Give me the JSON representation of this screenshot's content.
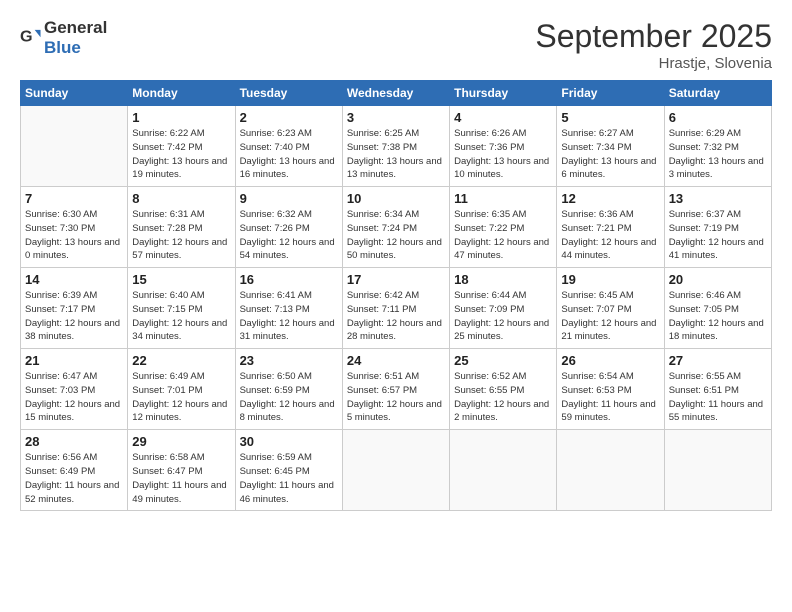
{
  "logo": {
    "general": "General",
    "blue": "Blue"
  },
  "title": "September 2025",
  "subtitle": "Hrastje, Slovenia",
  "headers": [
    "Sunday",
    "Monday",
    "Tuesday",
    "Wednesday",
    "Thursday",
    "Friday",
    "Saturday"
  ],
  "weeks": [
    [
      {
        "day": "",
        "sunrise": "",
        "sunset": "",
        "daylight": ""
      },
      {
        "day": "1",
        "sunrise": "Sunrise: 6:22 AM",
        "sunset": "Sunset: 7:42 PM",
        "daylight": "Daylight: 13 hours and 19 minutes."
      },
      {
        "day": "2",
        "sunrise": "Sunrise: 6:23 AM",
        "sunset": "Sunset: 7:40 PM",
        "daylight": "Daylight: 13 hours and 16 minutes."
      },
      {
        "day": "3",
        "sunrise": "Sunrise: 6:25 AM",
        "sunset": "Sunset: 7:38 PM",
        "daylight": "Daylight: 13 hours and 13 minutes."
      },
      {
        "day": "4",
        "sunrise": "Sunrise: 6:26 AM",
        "sunset": "Sunset: 7:36 PM",
        "daylight": "Daylight: 13 hours and 10 minutes."
      },
      {
        "day": "5",
        "sunrise": "Sunrise: 6:27 AM",
        "sunset": "Sunset: 7:34 PM",
        "daylight": "Daylight: 13 hours and 6 minutes."
      },
      {
        "day": "6",
        "sunrise": "Sunrise: 6:29 AM",
        "sunset": "Sunset: 7:32 PM",
        "daylight": "Daylight: 13 hours and 3 minutes."
      }
    ],
    [
      {
        "day": "7",
        "sunrise": "Sunrise: 6:30 AM",
        "sunset": "Sunset: 7:30 PM",
        "daylight": "Daylight: 13 hours and 0 minutes."
      },
      {
        "day": "8",
        "sunrise": "Sunrise: 6:31 AM",
        "sunset": "Sunset: 7:28 PM",
        "daylight": "Daylight: 12 hours and 57 minutes."
      },
      {
        "day": "9",
        "sunrise": "Sunrise: 6:32 AM",
        "sunset": "Sunset: 7:26 PM",
        "daylight": "Daylight: 12 hours and 54 minutes."
      },
      {
        "day": "10",
        "sunrise": "Sunrise: 6:34 AM",
        "sunset": "Sunset: 7:24 PM",
        "daylight": "Daylight: 12 hours and 50 minutes."
      },
      {
        "day": "11",
        "sunrise": "Sunrise: 6:35 AM",
        "sunset": "Sunset: 7:22 PM",
        "daylight": "Daylight: 12 hours and 47 minutes."
      },
      {
        "day": "12",
        "sunrise": "Sunrise: 6:36 AM",
        "sunset": "Sunset: 7:21 PM",
        "daylight": "Daylight: 12 hours and 44 minutes."
      },
      {
        "day": "13",
        "sunrise": "Sunrise: 6:37 AM",
        "sunset": "Sunset: 7:19 PM",
        "daylight": "Daylight: 12 hours and 41 minutes."
      }
    ],
    [
      {
        "day": "14",
        "sunrise": "Sunrise: 6:39 AM",
        "sunset": "Sunset: 7:17 PM",
        "daylight": "Daylight: 12 hours and 38 minutes."
      },
      {
        "day": "15",
        "sunrise": "Sunrise: 6:40 AM",
        "sunset": "Sunset: 7:15 PM",
        "daylight": "Daylight: 12 hours and 34 minutes."
      },
      {
        "day": "16",
        "sunrise": "Sunrise: 6:41 AM",
        "sunset": "Sunset: 7:13 PM",
        "daylight": "Daylight: 12 hours and 31 minutes."
      },
      {
        "day": "17",
        "sunrise": "Sunrise: 6:42 AM",
        "sunset": "Sunset: 7:11 PM",
        "daylight": "Daylight: 12 hours and 28 minutes."
      },
      {
        "day": "18",
        "sunrise": "Sunrise: 6:44 AM",
        "sunset": "Sunset: 7:09 PM",
        "daylight": "Daylight: 12 hours and 25 minutes."
      },
      {
        "day": "19",
        "sunrise": "Sunrise: 6:45 AM",
        "sunset": "Sunset: 7:07 PM",
        "daylight": "Daylight: 12 hours and 21 minutes."
      },
      {
        "day": "20",
        "sunrise": "Sunrise: 6:46 AM",
        "sunset": "Sunset: 7:05 PM",
        "daylight": "Daylight: 12 hours and 18 minutes."
      }
    ],
    [
      {
        "day": "21",
        "sunrise": "Sunrise: 6:47 AM",
        "sunset": "Sunset: 7:03 PM",
        "daylight": "Daylight: 12 hours and 15 minutes."
      },
      {
        "day": "22",
        "sunrise": "Sunrise: 6:49 AM",
        "sunset": "Sunset: 7:01 PM",
        "daylight": "Daylight: 12 hours and 12 minutes."
      },
      {
        "day": "23",
        "sunrise": "Sunrise: 6:50 AM",
        "sunset": "Sunset: 6:59 PM",
        "daylight": "Daylight: 12 hours and 8 minutes."
      },
      {
        "day": "24",
        "sunrise": "Sunrise: 6:51 AM",
        "sunset": "Sunset: 6:57 PM",
        "daylight": "Daylight: 12 hours and 5 minutes."
      },
      {
        "day": "25",
        "sunrise": "Sunrise: 6:52 AM",
        "sunset": "Sunset: 6:55 PM",
        "daylight": "Daylight: 12 hours and 2 minutes."
      },
      {
        "day": "26",
        "sunrise": "Sunrise: 6:54 AM",
        "sunset": "Sunset: 6:53 PM",
        "daylight": "Daylight: 11 hours and 59 minutes."
      },
      {
        "day": "27",
        "sunrise": "Sunrise: 6:55 AM",
        "sunset": "Sunset: 6:51 PM",
        "daylight": "Daylight: 11 hours and 55 minutes."
      }
    ],
    [
      {
        "day": "28",
        "sunrise": "Sunrise: 6:56 AM",
        "sunset": "Sunset: 6:49 PM",
        "daylight": "Daylight: 11 hours and 52 minutes."
      },
      {
        "day": "29",
        "sunrise": "Sunrise: 6:58 AM",
        "sunset": "Sunset: 6:47 PM",
        "daylight": "Daylight: 11 hours and 49 minutes."
      },
      {
        "day": "30",
        "sunrise": "Sunrise: 6:59 AM",
        "sunset": "Sunset: 6:45 PM",
        "daylight": "Daylight: 11 hours and 46 minutes."
      },
      {
        "day": "",
        "sunrise": "",
        "sunset": "",
        "daylight": ""
      },
      {
        "day": "",
        "sunrise": "",
        "sunset": "",
        "daylight": ""
      },
      {
        "day": "",
        "sunrise": "",
        "sunset": "",
        "daylight": ""
      },
      {
        "day": "",
        "sunrise": "",
        "sunset": "",
        "daylight": ""
      }
    ]
  ]
}
